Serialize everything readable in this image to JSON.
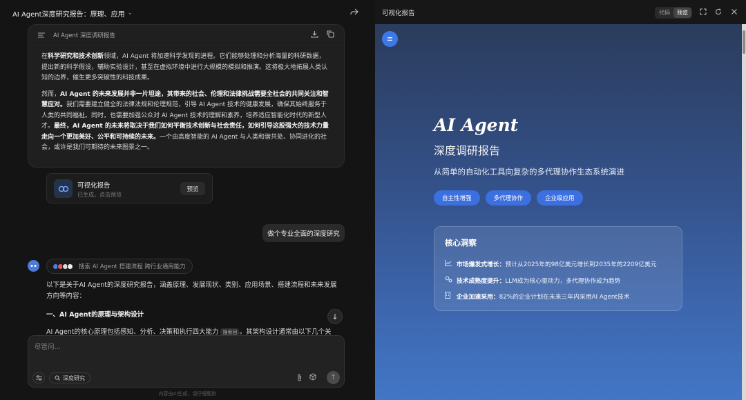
{
  "left": {
    "title": "AI Agent深度研究报告：原理、应用",
    "doc_card": {
      "title": "AI Agent 深度调研报告",
      "p1": [
        {
          "t": "在",
          "b": false
        },
        {
          "t": "科学研究和技术创新",
          "b": true
        },
        {
          "t": "领域，AI Agent 将加速科学发现的进程。它们能够处理和分析海量的科研数据，提出新的科学假设，辅助实验设计，甚至在虚拟环境中进行大规模的模拟和推演。这将极大地拓展人类认知的边界，催生更多突破性的科技成果。",
          "b": false
        }
      ],
      "p2": [
        {
          "t": "然而，",
          "b": false
        },
        {
          "t": "AI Agent 的未来发展并非一片坦途，其带来的社会、伦理和法律挑战需要全社会的共同关注和智慧应对。",
          "b": true
        },
        {
          "t": "我们需要建立健全的法律法规和伦理规范，引导 AI Agent 技术的健康发展，确保其始终服务于人类的共同福祉。同时，也需要加强公众对 AI Agent 技术的理解和素养，培养适应智能化时代的新型人才。",
          "b": false
        },
        {
          "t": "最终，AI Agent 的未来将取决于我们如何平衡技术创新与社会责任，如何引导这股强大的技术力量走向一个更加美好、公平和可持续的未来。",
          "b": true
        },
        {
          "t": "一个由高度智能的 AI Agent 与人类和谐共处、协同进化的社会，或许是我们可期待的未来图景之一。",
          "b": false
        }
      ]
    },
    "viz_card": {
      "title": "可视化报告",
      "subtitle": "已生成，点击预览",
      "button": "预览"
    },
    "user_message": "做个专业全面的深度研究",
    "search_pill": "搜索 AI Agent 搭建流程 跨行业通用能力",
    "answer": {
      "intro": "以下是关于AI Agent的深度研究报告，涵盖原理、发展现状、类别、应用场景、搭建流程和未来发展方向等内容：",
      "heading": "一、AI Agent的原理与架构设计",
      "line": "AI Agent的核心原理包括感知、分析、决策和执行四大能力",
      "cite": "搜索回",
      "line_tail": "。其架构设计通常由以下几个关"
    },
    "composer": {
      "placeholder": "尽管问...",
      "research_label": "深度研究"
    },
    "footer": "内容由AI生成，请仔细甄别"
  },
  "right": {
    "title": "可视化报告",
    "toggle": {
      "code": "代码",
      "preview": "预览"
    },
    "hero": {
      "title": "AI Agent",
      "subtitle": "深度调研报告",
      "desc": "从简单的自动化工具向复杂的多代理协作生态系统演进",
      "tags": [
        "自主性增强",
        "多代理协作",
        "企业级应用"
      ]
    },
    "insight": {
      "title": "核心洞察",
      "rows": [
        {
          "icon": "line-chart-icon",
          "label": "市场爆发式增长：",
          "text": "预计从2025年的98亿美元增长到2035年的2209亿美元"
        },
        {
          "icon": "gears-icon",
          "label": "技术成熟度提升：",
          "text": "LLM成为核心驱动力，多代理协作成为趋势"
        },
        {
          "icon": "building-icon",
          "label": "企业加速采用：",
          "text": "82%的企业计划在未来三年内采用AI Agent技术"
        }
      ]
    }
  }
}
